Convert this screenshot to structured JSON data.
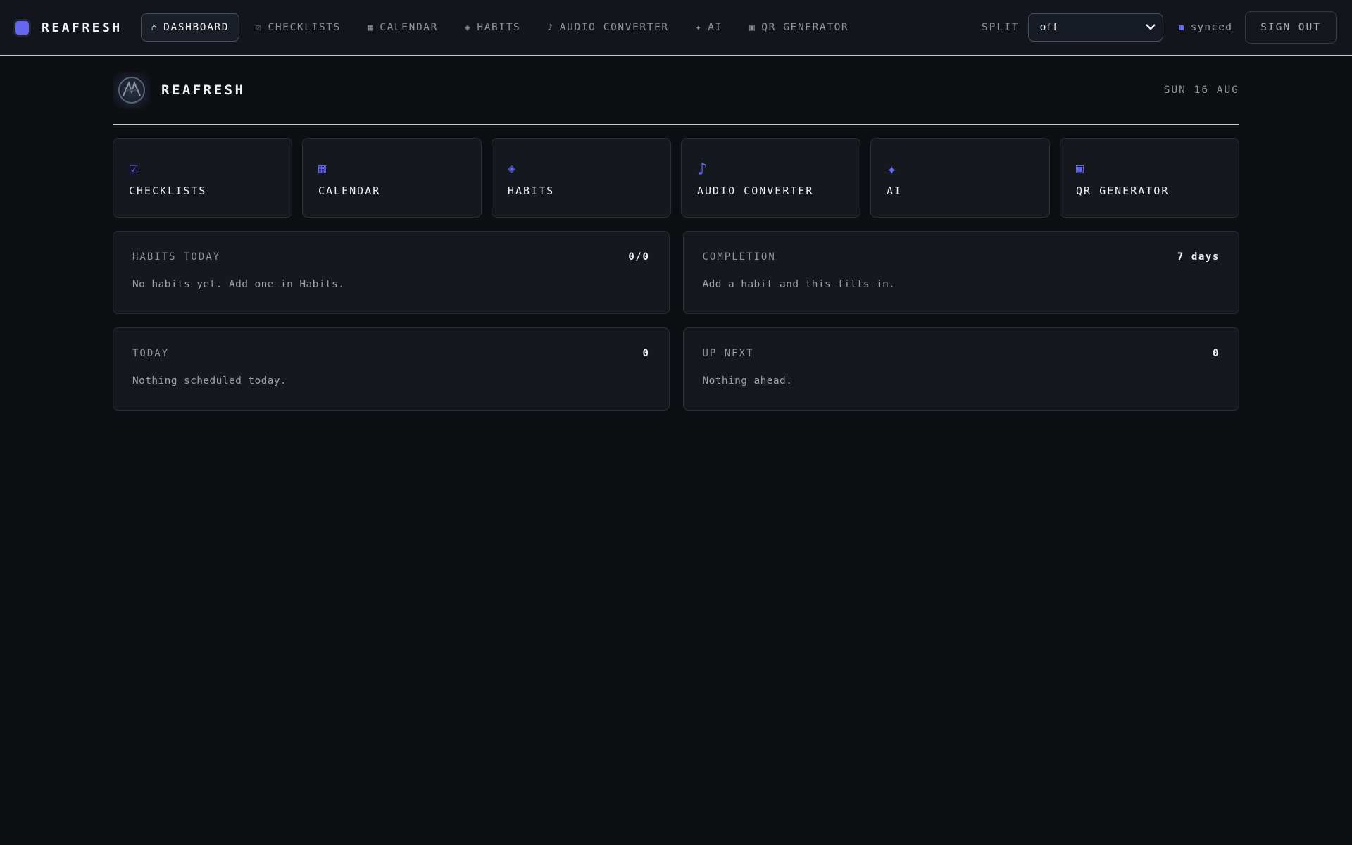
{
  "topbar": {
    "brand": "REAFRESH",
    "nav": [
      {
        "label": "DASHBOARD",
        "icon": "⌂"
      },
      {
        "label": "CHECKLISTS",
        "icon": "☑"
      },
      {
        "label": "CALENDAR",
        "icon": "▦"
      },
      {
        "label": "HABITS",
        "icon": "◈"
      },
      {
        "label": "AUDIO CONVERTER",
        "icon": "♪"
      },
      {
        "label": "AI",
        "icon": "✦"
      },
      {
        "label": "QR GENERATOR",
        "icon": "▣"
      }
    ],
    "split_label": "SPLIT",
    "split_value": "off",
    "sync_status": "synced",
    "sign_out": "SIGN OUT"
  },
  "page": {
    "title": "REAFRESH",
    "date": "SUN 16 AUG"
  },
  "tiles": [
    {
      "label": "CHECKLISTS",
      "icon": "☑"
    },
    {
      "label": "CALENDAR",
      "icon": "▦"
    },
    {
      "label": "HABITS",
      "icon": "◈"
    },
    {
      "label": "AUDIO CONVERTER",
      "icon": "♪"
    },
    {
      "label": "AI",
      "icon": "✦"
    },
    {
      "label": "QR GENERATOR",
      "icon": "▣"
    }
  ],
  "cards": {
    "habits_today": {
      "title": "HABITS TODAY",
      "value": "0/0",
      "body": "No habits yet. Add one in Habits."
    },
    "completion": {
      "title": "COMPLETION",
      "value": "7 days",
      "body": "Add a habit and this fills in."
    },
    "today": {
      "title": "TODAY",
      "value": "0",
      "body": "Nothing scheduled today."
    },
    "up_next": {
      "title": "UP NEXT",
      "value": "0",
      "body": "Nothing ahead."
    }
  },
  "colors": {
    "accent": "#6366f1",
    "background": "#0d0f13",
    "surface": "#15181f"
  }
}
